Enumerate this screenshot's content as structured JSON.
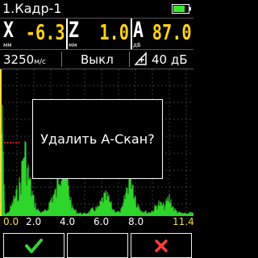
{
  "window": {
    "title": "1.Кадр-1",
    "battery_icon": "battery-icon",
    "battery_level": 0.8
  },
  "readings": {
    "x": {
      "letter": "X",
      "unit": "мм",
      "value": "-6.3"
    },
    "z": {
      "letter": "Z",
      "unit": "мм",
      "value": "1.0"
    },
    "a": {
      "letter": "A",
      "unit": "дБ",
      "value": "87.0"
    }
  },
  "params": {
    "velocity_value": "3250",
    "velocity_unit": "м/с",
    "mode": "Выкл",
    "gain_icon": "gain-icon",
    "gain": "40 дБ"
  },
  "axis_ticks": [
    "0.0",
    "2.0",
    "4.0",
    "6.0",
    "8.0",
    "11.4"
  ],
  "dialog": {
    "message": "Удалить А-Скан?"
  },
  "softkeys": {
    "confirm_icon": "check-icon",
    "cancel_icon": "cross-icon"
  },
  "colors": {
    "signal": "#2ed52a",
    "values": "#ffd21a",
    "gate": "#ff3030",
    "accent_axis": "#f5dc3c"
  }
}
